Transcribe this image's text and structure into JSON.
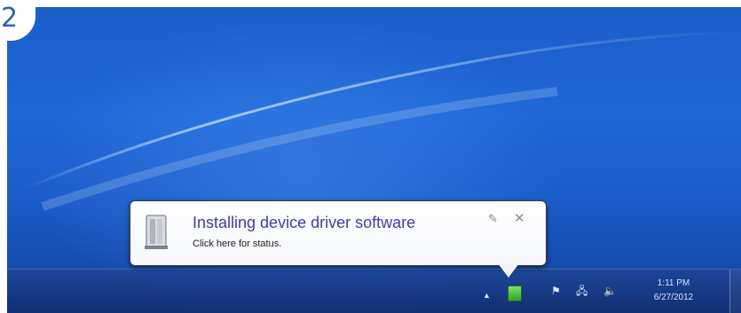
{
  "step_badge": "2",
  "notification": {
    "title": "Installing device driver software",
    "subtitle": "Click here for status.",
    "icon": "device-driver-icon",
    "options_icon": "✎",
    "close_icon": "✕"
  },
  "taskbar": {
    "tray_icons": [
      {
        "name": "show-hidden-icons-chevron",
        "glyph": "▲"
      },
      {
        "name": "device-install-icon",
        "glyph": ""
      },
      {
        "name": "action-center-flag-icon",
        "glyph": "⚑"
      },
      {
        "name": "network-icon",
        "glyph": "🖧"
      },
      {
        "name": "volume-icon",
        "glyph": "🔈"
      }
    ],
    "clock": {
      "time": "1:11 PM",
      "date": "6/27/2012"
    }
  },
  "colors": {
    "desktop_blue": "#1f68d6",
    "title_text": "#3b3fae",
    "tray_device_green": "#2fa52a"
  }
}
